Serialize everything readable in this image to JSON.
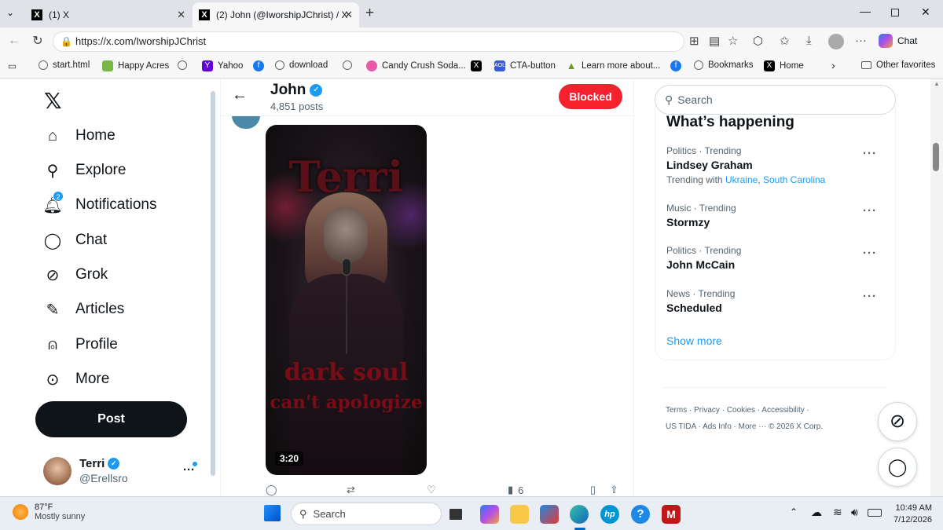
{
  "browser": {
    "tabs": [
      {
        "title": "(1) X"
      },
      {
        "title": "(2) John (@IworshipJChrist) / X"
      }
    ],
    "url": "https://x.com/IworshipJChrist",
    "chat_label": "Chat",
    "favorites": [
      "start.html",
      "Happy Acres",
      "Yahoo",
      "download",
      "Candy Crush Soda...",
      "CTA-button",
      "Learn more about...",
      "Bookmarks",
      "Home"
    ],
    "other_favorites": "Other favorites"
  },
  "sidebar": {
    "items": [
      {
        "label": "Home",
        "icon": "home-icon"
      },
      {
        "label": "Explore",
        "icon": "search-icon"
      },
      {
        "label": "Notifications",
        "icon": "bell-icon"
      },
      {
        "label": "Chat",
        "icon": "chat-bubble-icon"
      },
      {
        "label": "Grok",
        "icon": "grok-icon"
      },
      {
        "label": "Articles",
        "icon": "articles-icon"
      },
      {
        "label": "Profile",
        "icon": "person-icon"
      },
      {
        "label": "More",
        "icon": "more-circle-icon"
      }
    ],
    "notif_badge": "2",
    "post_label": "Post",
    "account": {
      "name": "Terri",
      "handle": "@Erellsro"
    }
  },
  "profile_header": {
    "name": "John",
    "posts": "4,851 posts",
    "blocked_label": "Blocked"
  },
  "post": {
    "video_title": "Terri",
    "video_caption_line1": "dark soul",
    "video_caption_line2": "can't apologize",
    "duration": "3:20",
    "views": "6"
  },
  "search": {
    "placeholder": "Search"
  },
  "trends": {
    "title": "What’s happening",
    "items": [
      {
        "category": "Politics · Trending",
        "name": "Lindsey Graham",
        "with_prefix": "Trending with",
        "with_links": [
          "Ukraine",
          "South Carolina"
        ]
      },
      {
        "category": "Music · Trending",
        "name": "Stormzy"
      },
      {
        "category": "Politics · Trending",
        "name": "John McCain"
      },
      {
        "category": "News · Trending",
        "name": "Scheduled"
      }
    ],
    "show_more": "Show more"
  },
  "footer": {
    "links": [
      "Terms",
      "Privacy",
      "Cookies",
      "Accessibility",
      "US TIDA",
      "Ads Info",
      "More ···"
    ],
    "copyright": "© 2026 X Corp."
  },
  "taskbar": {
    "temp": "87°F",
    "weather": "Mostly sunny",
    "search": "Search",
    "time": "10:49 AM",
    "date": "7/12/2026"
  },
  "colors": {
    "x_blue": "#1d9bf0",
    "blocked_red": "#f4212e",
    "dark": "#0f1419"
  }
}
